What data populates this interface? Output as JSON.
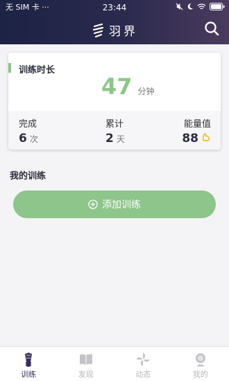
{
  "status_bar": {
    "carrier": "无 SIM 卡 ···",
    "time": "23:44"
  },
  "header": {
    "app_name": "羽界"
  },
  "summary_card": {
    "title": "训练时长",
    "duration_value": "47",
    "duration_unit": "分钟",
    "stats": [
      {
        "label": "完成",
        "value": "6",
        "unit": "次"
      },
      {
        "label": "累计",
        "value": "2",
        "unit": "天"
      },
      {
        "label": "能量值",
        "value": "88",
        "unit": ""
      }
    ]
  },
  "my_training": {
    "title": "我的训练",
    "add_button_label": "添加训练"
  },
  "tabbar": {
    "items": [
      {
        "label": "训练",
        "icon": "shuttlecock-icon",
        "active": true
      },
      {
        "label": "发现",
        "icon": "book-icon",
        "active": false
      },
      {
        "label": "动态",
        "icon": "pinwheel-icon",
        "active": false
      },
      {
        "label": "我的",
        "icon": "profile-icon",
        "active": false
      }
    ]
  },
  "colors": {
    "accent_green": "#8dc58a",
    "header_dark": "#1c2344",
    "tab_active": "#3a2e5c",
    "tab_inactive": "#b8b8bd"
  }
}
